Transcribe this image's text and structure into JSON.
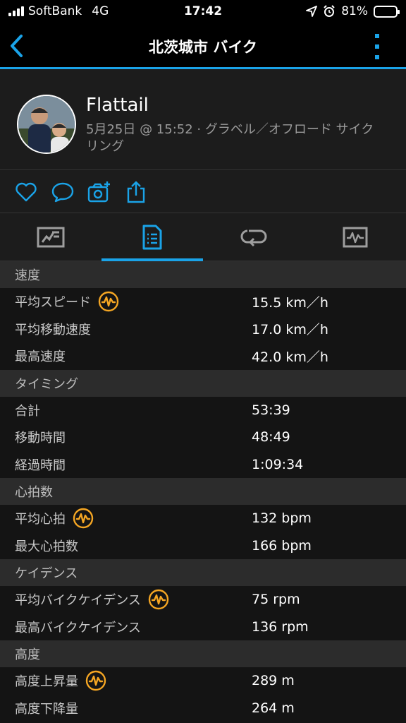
{
  "status_bar": {
    "carrier": "SoftBank",
    "network": "4G",
    "time": "17:42",
    "battery": "81%",
    "battery_level": 0.81
  },
  "nav": {
    "title": "北茨城市 バイク",
    "accent_color": "#1aa3e8"
  },
  "profile": {
    "name": "Flattail",
    "meta": "5月25日 @ 15:52 · グラベル／オフロード サイクリング"
  },
  "actions": [
    "heart-icon",
    "comment-icon",
    "camera-add-icon",
    "share-icon"
  ],
  "tabs": [
    {
      "icon": "map-overview-icon",
      "active": false
    },
    {
      "icon": "stats-list-icon",
      "active": true
    },
    {
      "icon": "laps-loop-icon",
      "active": false
    },
    {
      "icon": "chart-icon",
      "active": false
    }
  ],
  "colors": {
    "accent": "#1aa3e8",
    "badge": "#f5a623"
  },
  "sections": [
    {
      "title": "速度",
      "rows": [
        {
          "label": "平均スピード",
          "value": "15.5 km／h",
          "badge": true
        },
        {
          "label": "平均移動速度",
          "value": "17.0 km／h",
          "badge": false
        },
        {
          "label": "最高速度",
          "value": "42.0 km／h",
          "badge": false
        }
      ]
    },
    {
      "title": "タイミング",
      "rows": [
        {
          "label": "合計",
          "value": "53:39",
          "badge": false
        },
        {
          "label": "移動時間",
          "value": "48:49",
          "badge": false
        },
        {
          "label": "経過時間",
          "value": "1:09:34",
          "badge": false
        }
      ]
    },
    {
      "title": "心拍数",
      "rows": [
        {
          "label": "平均心拍",
          "value": "132 bpm",
          "badge": true
        },
        {
          "label": "最大心拍数",
          "value": "166 bpm",
          "badge": false
        }
      ]
    },
    {
      "title": "ケイデンス",
      "rows": [
        {
          "label": "平均バイクケイデンス",
          "value": "75 rpm",
          "badge": true
        },
        {
          "label": "最高バイクケイデンス",
          "value": "136 rpm",
          "badge": false
        }
      ]
    },
    {
      "title": "高度",
      "rows": [
        {
          "label": "高度上昇量",
          "value": "289 m",
          "badge": true
        },
        {
          "label": "高度下降量",
          "value": "264 m",
          "badge": false
        }
      ]
    }
  ]
}
